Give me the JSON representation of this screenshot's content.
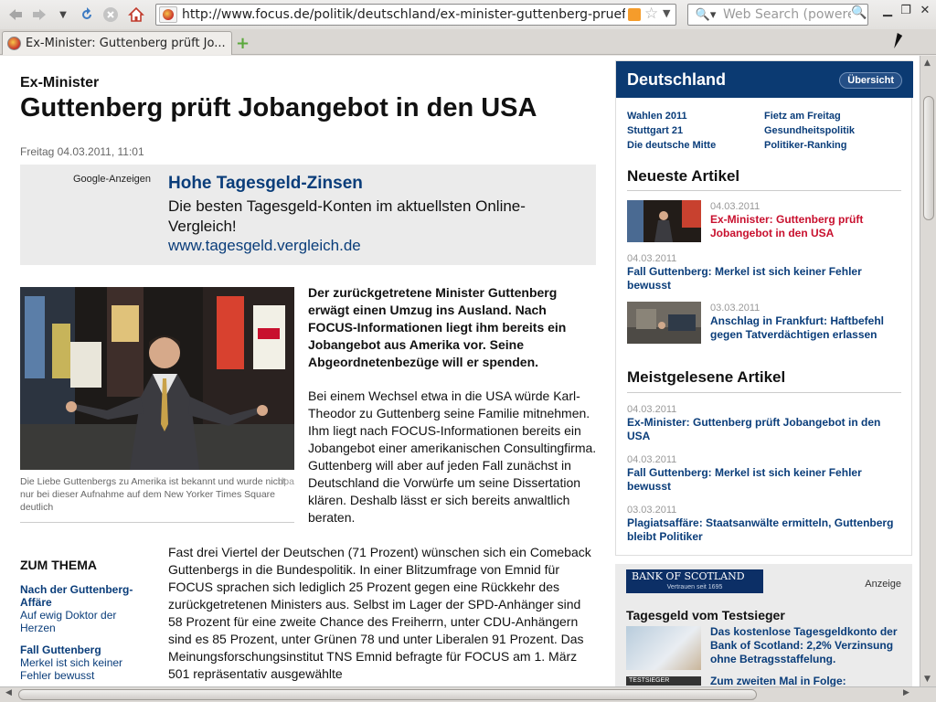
{
  "browser": {
    "url": "http://www.focus.de/politik/deutschland/ex-minister-guttenberg-prueft-joba",
    "search_placeholder": "Web Search (powered",
    "tab_title": "Ex-Minister: Guttenberg prüft Jo...",
    "icons": [
      "back-icon",
      "forward-icon",
      "history-dropdown-icon",
      "reload-icon",
      "stop-icon",
      "home-icon",
      "rss-icon",
      "bookmark-star-icon",
      "search-engine-icon",
      "search-go-icon",
      "minimize-icon",
      "restore-icon",
      "close-icon",
      "new-tab-icon"
    ]
  },
  "article": {
    "kicker": "Ex-Minister",
    "headline": "Guttenberg prüft Jobangebot in den USA",
    "date": "Freitag 04.03.2011, 11:01",
    "ad": {
      "label": "Google-Anzeigen",
      "title": "Hohe Tagesgeld-Zinsen",
      "text": "Die besten Tagesgeld-Konten im aktuellsten Online-Vergleich!",
      "url": "www.tagesgeld.vergleich.de"
    },
    "photo_caption": "Die Liebe Guttenbergs zu Amerika ist bekannt und wurde nicht nur bei dieser Aufnahme auf dem New Yorker Times Square deutlich",
    "photo_credit": "dpa",
    "lead": "Der zurückgetretene Minister Guttenberg erwägt einen Umzug ins Ausland. Nach FOCUS-Informationen liegt ihm bereits ein Jobangebot aus Amerika vor. Seine Abgeordnetenbezüge will er spenden.",
    "body1": "Bei einem Wechsel etwa in die USA würde Karl-Theodor zu Guttenberg seine Familie mitnehmen. Ihm liegt nach FOCUS-Informationen bereits ein Jobangebot einer amerikanischen Consultingfirma. Guttenberg will aber auf jeden Fall zunächst in Deutschland die Vorwürfe um seine Dissertation klären. Deshalb lässt er sich bereits anwaltlich beraten.",
    "body2": "Fast drei Viertel der Deutschen (71 Prozent) wünschen sich ein Comeback Guttenbergs in die Bundespolitik. In einer Blitzumfrage von Emnid für FOCUS sprachen sich lediglich 25 Prozent gegen eine Rückkehr des zurückgetretenen Ministers aus. Selbst im Lager der SPD-Anhänger sind 58 Prozent für eine zweite Chance des Freiherrn, unter CDU-Anhängern sind es 85 Prozent, unter Grünen 78 und unter Liberalen 91 Prozent. Das Meinungsforschungsinstitut TNS Emnid befragte für FOCUS am 1. März 501 repräsentativ ausgewählte",
    "zum_thema": {
      "heading": "ZUM THEMA",
      "items": [
        {
          "title": "Nach der Guttenberg-Affäre",
          "desc": "Auf ewig Doktor der Herzen"
        },
        {
          "title": "Fall Guttenberg",
          "desc": "Merkel ist sich keiner Fehler bewusst"
        }
      ]
    }
  },
  "sidebar": {
    "title": "Deutschland",
    "overview_button": "Übersicht",
    "links_left": [
      "Wahlen 2011",
      "Stuttgart 21",
      "Die deutsche Mitte"
    ],
    "links_right": [
      "Fietz am Freitag",
      "Gesundheitspolitik",
      "Politiker-Ranking"
    ],
    "newest_heading": "Neueste Artikel",
    "newest": [
      {
        "date": "04.03.2011",
        "title": "Ex-Minister: Guttenberg prüft Jobangebot in den USA"
      },
      {
        "date": "04.03.2011",
        "title": "Fall Guttenberg: Merkel ist sich keiner Fehler bewusst"
      },
      {
        "date": "03.03.2011",
        "title": "Anschlag in Frankfurt: Haftbefehl gegen Tatverdächtigen erlassen"
      }
    ],
    "most_read_heading": "Meistgelesene Artikel",
    "most_read": [
      {
        "date": "04.03.2011",
        "title": "Ex-Minister: Guttenberg prüft Jobangebot in den USA"
      },
      {
        "date": "04.03.2011",
        "title": "Fall Guttenberg: Merkel ist sich keiner Fehler bewusst"
      },
      {
        "date": "03.03.2011",
        "title": "Plagiatsaffäre: Staatsanwälte ermitteln, Guttenberg bleibt Politiker"
      }
    ]
  },
  "ad_panel": {
    "logo": "BANK OF SCOTLAND",
    "logo_sub": "Vertrauen seit 1695",
    "anzeige": "Anzeige",
    "title": "Tagesgeld vom Testsieger",
    "text": "Das kostenlose Tagesgeldkonto der Bank of Scotland: 2,2% Verzinsung ohne Betragsstaffelung.",
    "badge": "TESTSIEGER",
    "text2": "Zum zweiten Mal in Folge:"
  },
  "colors": {
    "brand_blue": "#0b3a72",
    "link_blue": "#0a3d7a",
    "active_red": "#c8102e"
  }
}
